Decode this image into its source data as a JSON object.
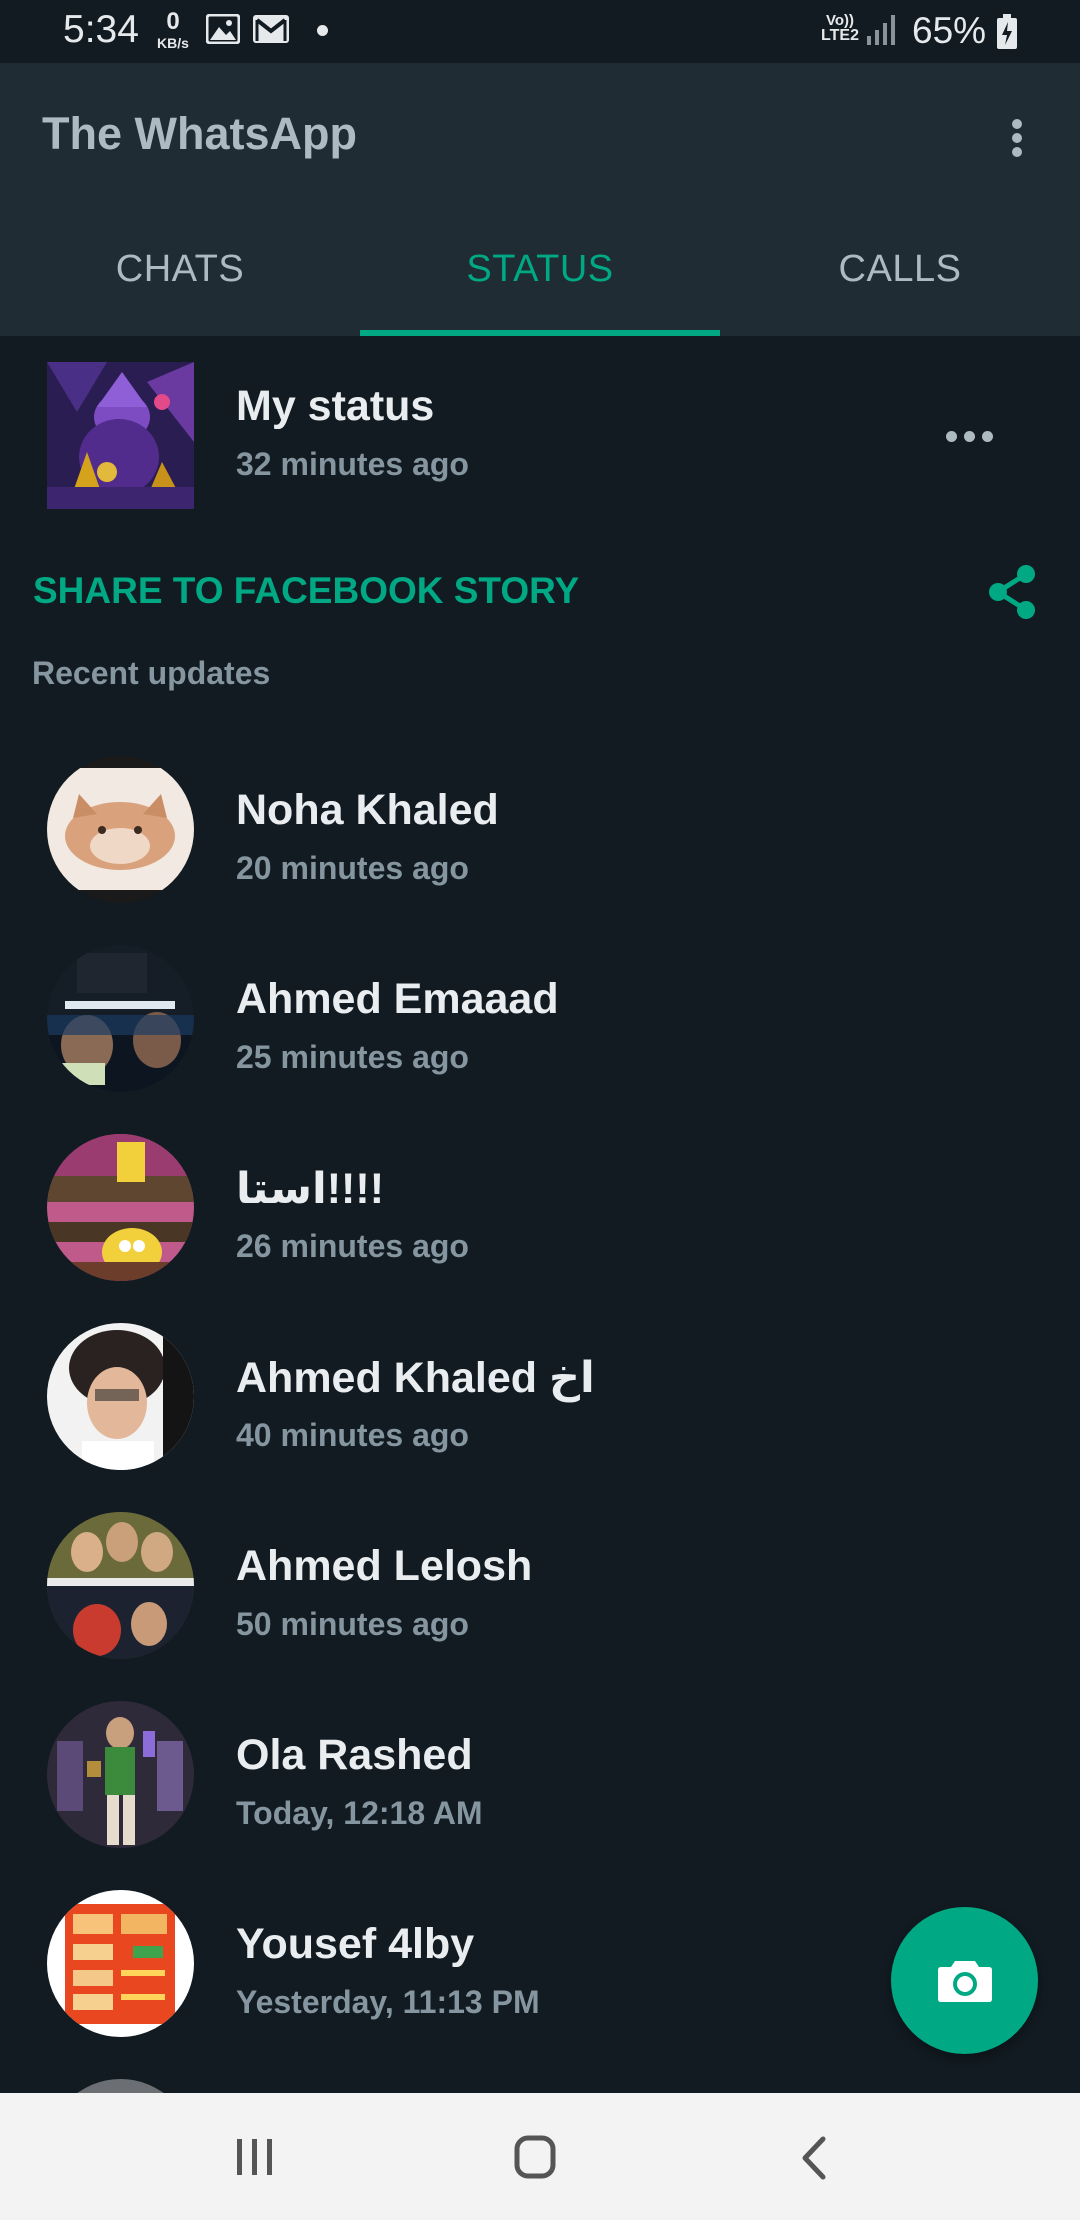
{
  "status_bar": {
    "time": "5:34",
    "net_speed_value": "0",
    "net_speed_unit": "KB/s",
    "network_top": "Vo))",
    "network_bottom": "LTE2",
    "battery": "65%"
  },
  "app_bar": {
    "title": "The WhatsApp"
  },
  "tabs": [
    {
      "label": "CHATS"
    },
    {
      "label": "STATUS"
    },
    {
      "label": "CALLS"
    }
  ],
  "active_tab": "STATUS",
  "my_status": {
    "name": "My status",
    "time": "32 minutes ago"
  },
  "share": {
    "label": "SHARE TO FACEBOOK STORY"
  },
  "recent_header": "Recent updates",
  "updates": [
    {
      "name": "Noha Khaled",
      "time": "20 minutes ago"
    },
    {
      "name": "Ahmed Emaaad",
      "time": "25 minutes ago"
    },
    {
      "name": "استا!!!!",
      "time": "26 minutes ago"
    },
    {
      "name": "Ahmed Khaled اخ",
      "time": "40 minutes ago"
    },
    {
      "name": "Ahmed Lelosh",
      "time": "50 minutes ago"
    },
    {
      "name": "Ola Rashed",
      "time": "Today, 12:18 AM"
    },
    {
      "name": "Yousef 4lby",
      "time": "Yesterday, 11:13 PM"
    }
  ],
  "colors": {
    "accent": "#00a884",
    "background": "#121b22",
    "header": "#1f2c34",
    "primary_text": "#e9edef",
    "secondary_text": "#8696a0"
  },
  "icons": {
    "menu": "more-vert-icon",
    "more": "more-horiz-icon",
    "share": "share-icon",
    "fab": "camera-icon",
    "nav": [
      "recents-icon",
      "home-icon",
      "back-icon"
    ]
  }
}
